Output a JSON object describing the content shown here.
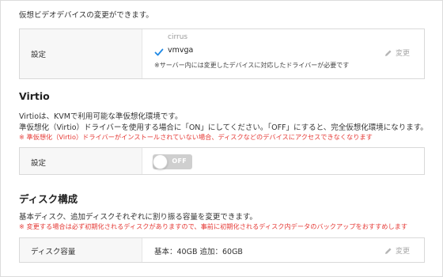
{
  "top_description": "仮想ビデオデバイスの変更ができます。",
  "video_device": {
    "label": "設定",
    "option_unselected": "cirrus",
    "option_selected": "vmvga",
    "note": "※サーバー内には変更したデバイスに対応したドライバーが必要です",
    "edit_label": "変更"
  },
  "virtio": {
    "heading": "Virtio",
    "desc_line1": "Virtioは、KVMで利用可能な準仮想化環境です。",
    "desc_line2": "準仮想化（Virtio）ドライバーを使用する場合に「ON」にしてください。「OFF」にすると、完全仮想化環境になります。",
    "warning": "※ 準仮想化（Virtio）ドライバーがインストールされていない場合、ディスクなどのデバイスにアクセスできなくなります",
    "label": "設定",
    "toggle_state": "OFF"
  },
  "disk": {
    "heading": "ディスク構成",
    "desc": "基本ディスク、追加ディスクそれぞれに割り振る容量を変更できます。",
    "warning": "※ 変更する場合は必ず初期化されるディスクがありますので、事前に初期化されるディスク内データのバックアップをおすすめします",
    "label": "ディスク容量",
    "value": "基本：40GB 追加：60GB",
    "edit_label": "変更"
  },
  "colors": {
    "accent_check": "#1e88e5",
    "warning_text": "#e53935",
    "toggle_off": "#cfcfcf"
  }
}
